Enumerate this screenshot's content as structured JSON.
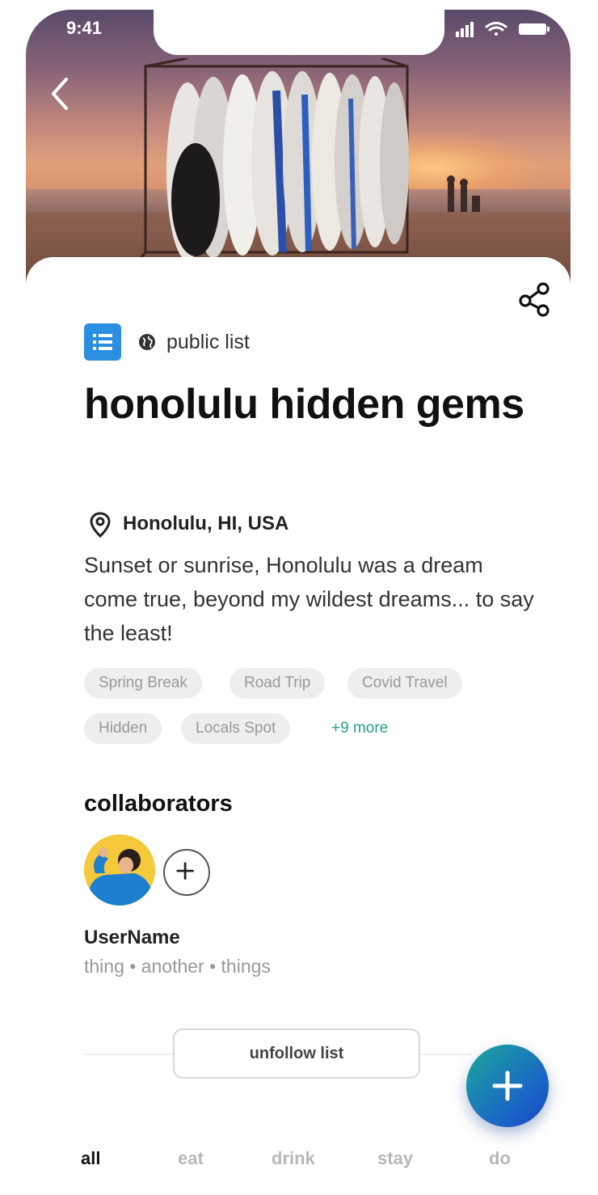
{
  "status_bar": {
    "time": "9:41"
  },
  "list": {
    "visibility_label": "public list",
    "title": "honolulu hidden gems",
    "location": "Honolulu, HI, USA",
    "description": "Sunset or sunrise, Honolulu was a dream come true, beyond my wildest dreams... to say the least!",
    "tags": [
      "Spring Break",
      "Road Trip",
      "Covid Travel",
      "Hidden",
      "Locals Spot"
    ],
    "more_tags": "+9 more"
  },
  "collaborators": {
    "heading": "collaborators",
    "user": {
      "name": "UserName",
      "meta": "thing • another • things"
    }
  },
  "actions": {
    "unfollow": "unfollow list"
  },
  "tabs": [
    "all",
    "eat",
    "drink",
    "stay",
    "do"
  ],
  "colors": {
    "badge_blue": "#2a8fe0",
    "link_teal": "#2a9d8f",
    "fab_start": "#1aa89a",
    "fab_end": "#1a45b8"
  },
  "icons": [
    "back-icon",
    "share-icon",
    "list-icon",
    "globe-icon",
    "location-pin-icon",
    "plus-icon",
    "fab-plus-icon"
  ]
}
